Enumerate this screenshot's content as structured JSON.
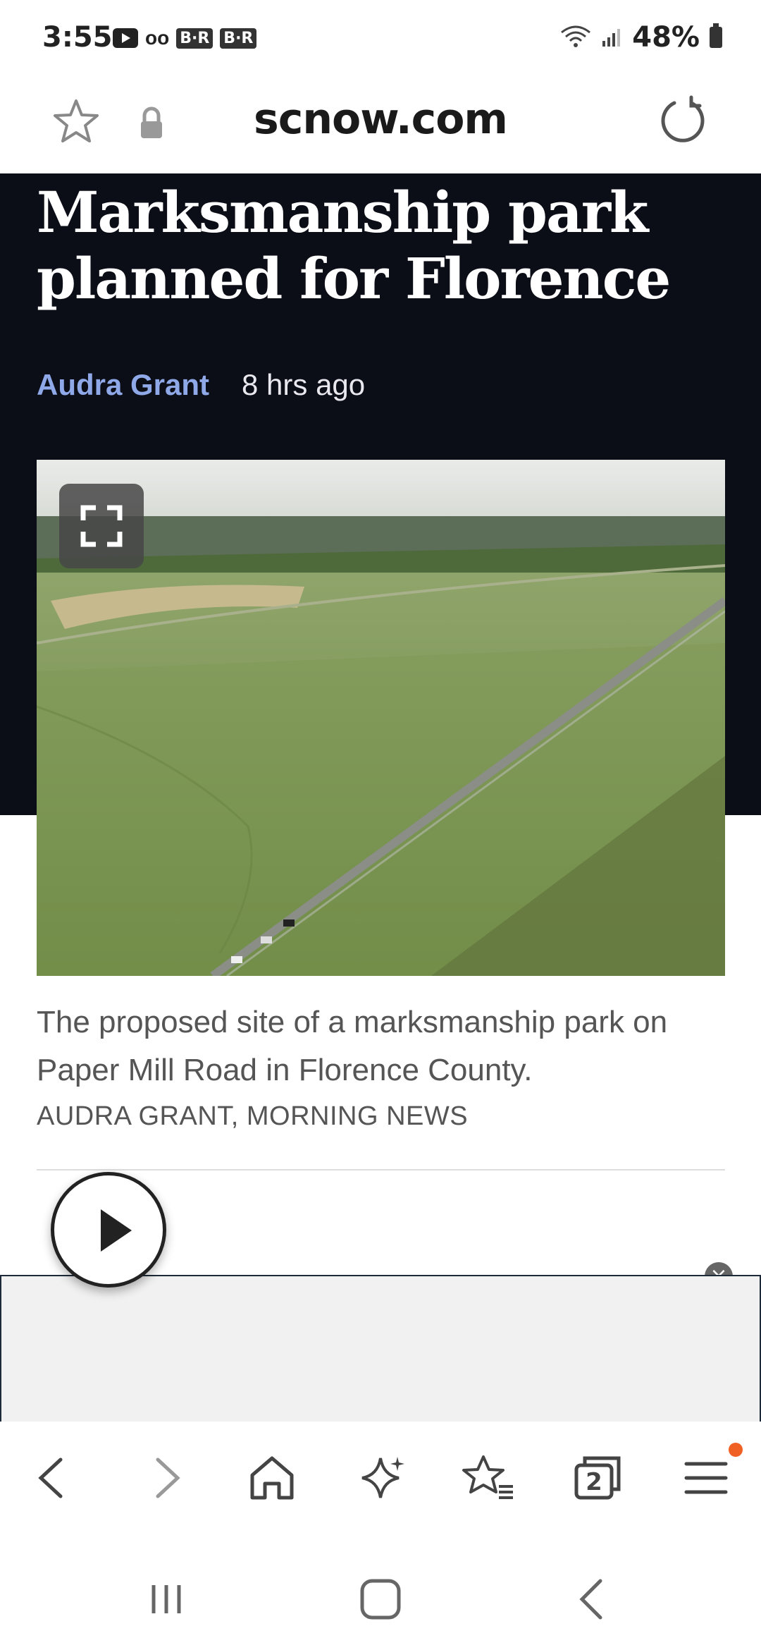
{
  "status_bar": {
    "time": "3:55",
    "chip1": "B·R",
    "chip2": "B·R",
    "battery": "48%"
  },
  "browser": {
    "url": "scnow.com"
  },
  "article": {
    "headline": "Marksmanship park planned for Florence",
    "author": "Audra Grant",
    "time_ago": "8 hrs ago",
    "caption": "The proposed site of a marksmanship park on Paper Mill Road in Florence County.",
    "credit": "AUDRA GRANT, MORNING NEWS"
  },
  "ad": {
    "close_label": "×"
  },
  "toolbar": {
    "tabs_count": "2"
  },
  "colors": {
    "header_bg": "#0b0d17",
    "author_link": "#8fa8e8",
    "notification_dot": "#f06022"
  }
}
